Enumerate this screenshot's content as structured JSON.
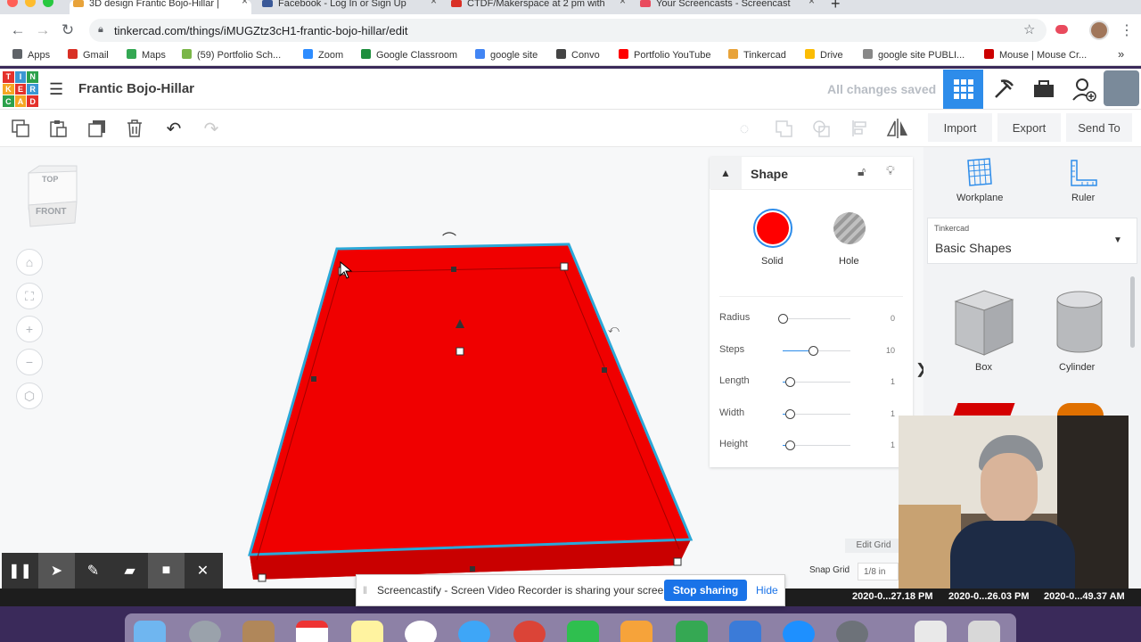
{
  "browser": {
    "tabs": [
      {
        "title": "3D design Frantic Bojo-Hillar |",
        "active": true,
        "icon_color": "#e8a33a"
      },
      {
        "title": "Facebook - Log In or Sign Up",
        "active": false,
        "icon_color": "#3b5998"
      },
      {
        "title": "CTDF/Makerspace at 2 pm with",
        "active": false,
        "icon_color": "#d93025"
      },
      {
        "title": "Your Screencasts - Screencast",
        "active": false,
        "icon_color": "#e94a5d"
      }
    ],
    "url": "tinkercad.com/things/iMUGZtz3cH1-frantic-bojo-hillar/edit",
    "bookmarks": [
      {
        "label": "Apps",
        "icon_color": "#5f6368"
      },
      {
        "label": "Gmail",
        "icon_color": "#d93025"
      },
      {
        "label": "Maps",
        "icon_color": "#34a853"
      },
      {
        "label": "(59) Portfolio Sch...",
        "icon_color": "#7ab648"
      },
      {
        "label": "Zoom",
        "icon_color": "#2d8cff"
      },
      {
        "label": "Google Classroom",
        "icon_color": "#1e8e3e"
      },
      {
        "label": "google site",
        "icon_color": "#4285f4"
      },
      {
        "label": "Convo",
        "icon_color": "#444444"
      },
      {
        "label": "Portfolio YouTube",
        "icon_color": "#ff0000"
      },
      {
        "label": "Tinkercad",
        "icon_color": "#e8a33a"
      },
      {
        "label": "Drive",
        "icon_color": "#fbbc04"
      },
      {
        "label": "google site PUBLI...",
        "icon_color": "#888888"
      },
      {
        "label": "Mouse | Mouse Cr...",
        "icon_color": "#cc0000"
      }
    ],
    "more": "»"
  },
  "tinkercad": {
    "logo_letters": [
      "TIN",
      "KER",
      "CAD"
    ],
    "design_title": "Frantic Bojo-Hillar",
    "save_status": "All changes saved",
    "toolbar": {
      "import": "Import",
      "export": "Export",
      "send_to": "Send To"
    },
    "viewcube": {
      "top": "TOP",
      "front": "FRONT"
    },
    "shape_panel": {
      "title": "Shape",
      "solid_label": "Solid",
      "hole_label": "Hole",
      "solid_color": "#ff0000",
      "properties": [
        {
          "label": "Radius",
          "value": "0",
          "fraction": 0.0
        },
        {
          "label": "Steps",
          "value": "10",
          "fraction": 0.45
        },
        {
          "label": "Length",
          "value": "1",
          "fraction": 0.1
        },
        {
          "label": "Width",
          "value": "1",
          "fraction": 0.1
        },
        {
          "label": "Height",
          "value": "1",
          "fraction": 0.1
        }
      ]
    },
    "right_panel": {
      "workplane": "Workplane",
      "ruler": "Ruler",
      "library_source": "Tinkercad",
      "library_name": "Basic Shapes",
      "shapes": [
        {
          "label": "Box"
        },
        {
          "label": "Cylinder"
        }
      ]
    },
    "edit_grid": "Edit Grid",
    "snap_grid_label": "Snap Grid",
    "snap_grid_value": "1/8 in"
  },
  "screencastify": {
    "share_message": "Screencastify - Screen Video Recorder is sharing your screen.",
    "stop_button": "Stop sharing",
    "hide_button": "Hide"
  },
  "desktop": {
    "file_labels": [
      "2020-0...27.18 PM",
      "2020-0...26.03 PM",
      "2020-0...49.37 AM"
    ]
  }
}
